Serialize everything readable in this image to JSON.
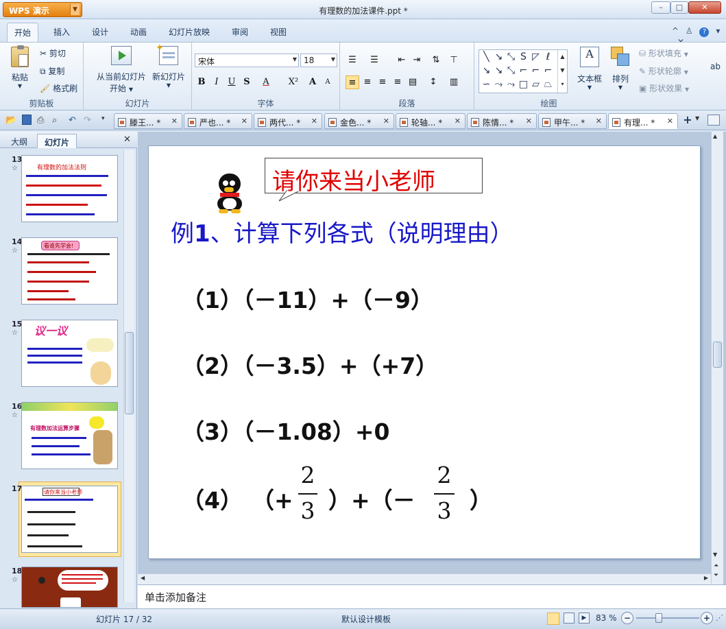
{
  "window": {
    "app_button": "WPS 演示",
    "title": "有理数的加法课件.ppt *"
  },
  "ribbon_tabs": [
    "开始",
    "插入",
    "设计",
    "动画",
    "幻灯片放映",
    "审阅",
    "视图"
  ],
  "ribbon": {
    "clipboard": {
      "paste": "粘贴",
      "cut": "剪切",
      "copy": "复制",
      "format_painter": "格式刷",
      "group": "剪贴板"
    },
    "slides": {
      "from_current": "从当前幻灯片",
      "start": "开始",
      "new_slide": "新幻灯片",
      "group": "幻灯片"
    },
    "font": {
      "name": "宋体",
      "size": "18",
      "group": "字体",
      "bold": "B",
      "italic": "I",
      "underline": "U",
      "shadow": "S",
      "color": "A",
      "superscript": "X²",
      "grow": "A",
      "shrink": "A"
    },
    "paragraph": {
      "group": "段落"
    },
    "drawing": {
      "textbox": "文本框",
      "arrange": "排列",
      "shape_fill": "形状填充",
      "shape_outline": "形状轮廓",
      "shape_effect": "形状效果",
      "group": "绘图"
    }
  },
  "doc_tabs": [
    {
      "label": "滕王...",
      "modified": "*"
    },
    {
      "label": "严也...",
      "modified": "*"
    },
    {
      "label": "两代...",
      "modified": "*"
    },
    {
      "label": "金色...",
      "modified": "*"
    },
    {
      "label": "轮轴...",
      "modified": "*"
    },
    {
      "label": "陈情...",
      "modified": "*"
    },
    {
      "label": "甲午...",
      "modified": "*"
    },
    {
      "label": "有理...",
      "modified": "*"
    }
  ],
  "panel_tabs": {
    "outline": "大纲",
    "slides": "幻灯片"
  },
  "thumbnails": [
    {
      "num": "13",
      "title": "有理数的加法法则"
    },
    {
      "num": "14",
      "title": "看谁先学会!"
    },
    {
      "num": "15",
      "title": "议一议"
    },
    {
      "num": "16",
      "title": "有理数加法运算步骤"
    },
    {
      "num": "17",
      "title": "请你来当小老师"
    },
    {
      "num": "18",
      "title": ""
    }
  ],
  "slide": {
    "callout": "请你来当小老师",
    "heading_prefix": "例",
    "heading_num": "1",
    "heading_rest": "、计算下列各式（说明理由）",
    "items": [
      "（1）（－11）+（－9）",
      "（2）（－3.5）+（+7）",
      "（3）（－1.08）+0"
    ],
    "item4": {
      "label": "（4）",
      "open1": "（+",
      "close1": "）+（－",
      "close2": "）"
    },
    "fraction1": {
      "num": "2",
      "den": "3"
    },
    "fraction2": {
      "num": "2",
      "den": "3"
    }
  },
  "notes_placeholder": "单击添加备注",
  "status": {
    "slide_counter": "幻灯片 17 / 32",
    "template": "默认设计模板",
    "zoom": "83 %"
  }
}
